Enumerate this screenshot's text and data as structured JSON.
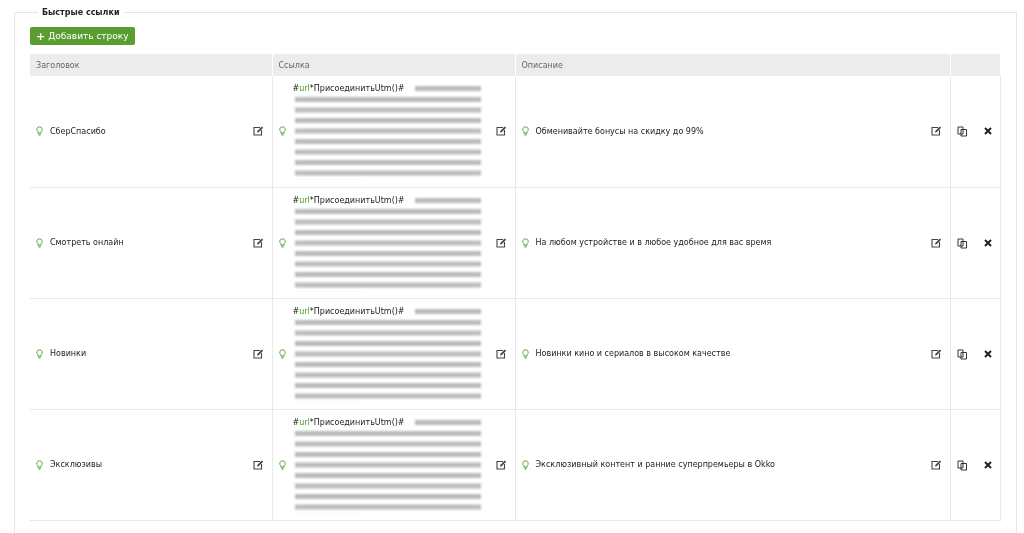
{
  "section": {
    "legend": "Быстрые ссылки"
  },
  "add_button": {
    "icon": "+",
    "label": "Добавить строку"
  },
  "table": {
    "columns": [
      "Заголовок",
      "Ссылка",
      "Описание"
    ],
    "rows": [
      {
        "title": "СберСпасибо",
        "link_prefix": "#",
        "link_keyword": "url",
        "link_suffix": "*ПрисоединитьUtm()#",
        "description": "Обменивайте бонусы на скидку до 99%"
      },
      {
        "title": "Смотреть онлайн",
        "link_prefix": "#",
        "link_keyword": "url",
        "link_suffix": "*ПрисоединитьUtm()#",
        "description": "На любом устройстве и в любое удобное для вас время"
      },
      {
        "title": "Новинки",
        "link_prefix": "#",
        "link_keyword": "url",
        "link_suffix": "*ПрисоединитьUtm()#",
        "description": "Новинки кино и сериалов в высоком качестве"
      },
      {
        "title": "Эксклюзивы",
        "link_prefix": "#",
        "link_keyword": "url",
        "link_suffix": "*ПрисоединитьUtm()#",
        "description": "Эксклюзивный контент и ранние суперпремьеры в Okko"
      }
    ]
  }
}
